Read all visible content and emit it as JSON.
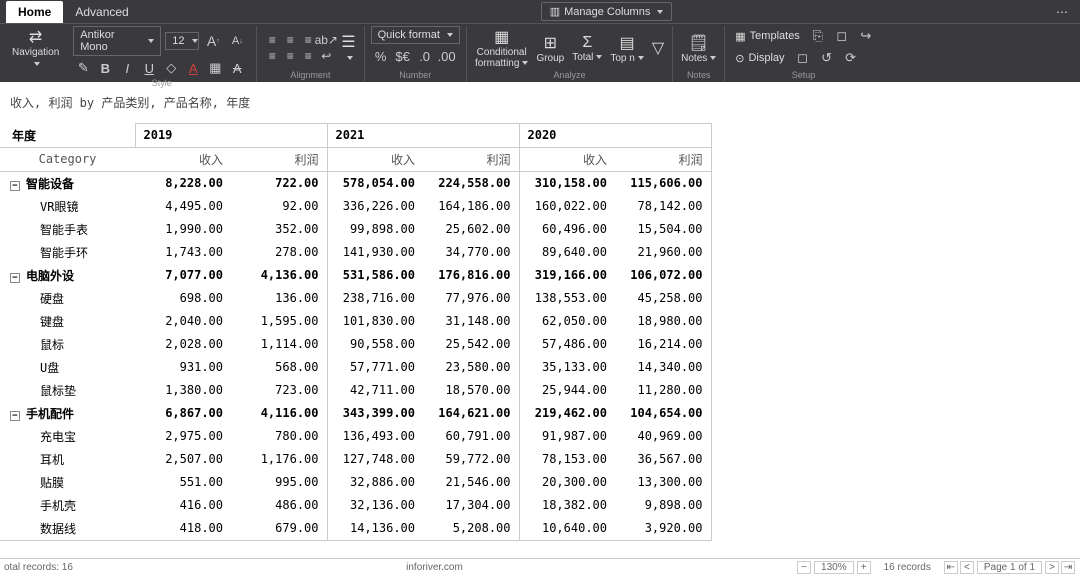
{
  "tabs": {
    "home": "Home",
    "advanced": "Advanced"
  },
  "manage_columns": "Manage Columns",
  "navigation": "Navigation",
  "font": {
    "name": "Antikor Mono",
    "size": "12",
    "increase": "A",
    "decrease": "A"
  },
  "quick_format": "Quick format",
  "analyze": {
    "conditional": "Conditional",
    "formatting": "formatting",
    "group": "Group",
    "total": "Total",
    "topn": "Top n"
  },
  "notes": "Notes",
  "setup": {
    "templates": "Templates",
    "display": "Display"
  },
  "group_labels": {
    "style": "Style",
    "alignment": "Alignment",
    "number": "Number",
    "analyze": "Analyze",
    "notes": "Notes",
    "setup": "Setup"
  },
  "caption": "收入, 利润 by 产品类别, 产品名称, 年度",
  "table": {
    "header": {
      "year_label": "年度",
      "category": "Category",
      "years": [
        "2019",
        "2021",
        "2020"
      ],
      "metrics": [
        "收入",
        "利润"
      ]
    },
    "groups": [
      {
        "name": "智能设备",
        "totals": [
          "8,228.00",
          "722.00",
          "578,054.00",
          "224,558.00",
          "310,158.00",
          "115,606.00"
        ],
        "rows": [
          {
            "name": "VR眼镜",
            "v": [
              "4,495.00",
              "92.00",
              "336,226.00",
              "164,186.00",
              "160,022.00",
              "78,142.00"
            ]
          },
          {
            "name": "智能手表",
            "v": [
              "1,990.00",
              "352.00",
              "99,898.00",
              "25,602.00",
              "60,496.00",
              "15,504.00"
            ]
          },
          {
            "name": "智能手环",
            "v": [
              "1,743.00",
              "278.00",
              "141,930.00",
              "34,770.00",
              "89,640.00",
              "21,960.00"
            ]
          }
        ]
      },
      {
        "name": "电脑外设",
        "totals": [
          "7,077.00",
          "4,136.00",
          "531,586.00",
          "176,816.00",
          "319,166.00",
          "106,072.00"
        ],
        "rows": [
          {
            "name": "硬盘",
            "v": [
              "698.00",
              "136.00",
              "238,716.00",
              "77,976.00",
              "138,553.00",
              "45,258.00"
            ]
          },
          {
            "name": "键盘",
            "v": [
              "2,040.00",
              "1,595.00",
              "101,830.00",
              "31,148.00",
              "62,050.00",
              "18,980.00"
            ]
          },
          {
            "name": "鼠标",
            "v": [
              "2,028.00",
              "1,114.00",
              "90,558.00",
              "25,542.00",
              "57,486.00",
              "16,214.00"
            ]
          },
          {
            "name": "U盘",
            "v": [
              "931.00",
              "568.00",
              "57,771.00",
              "23,580.00",
              "35,133.00",
              "14,340.00"
            ]
          },
          {
            "name": "鼠标垫",
            "v": [
              "1,380.00",
              "723.00",
              "42,711.00",
              "18,570.00",
              "25,944.00",
              "11,280.00"
            ]
          }
        ]
      },
      {
        "name": "手机配件",
        "totals": [
          "6,867.00",
          "4,116.00",
          "343,399.00",
          "164,621.00",
          "219,462.00",
          "104,654.00"
        ],
        "rows": [
          {
            "name": "充电宝",
            "v": [
              "2,975.00",
              "780.00",
              "136,493.00",
              "60,791.00",
              "91,987.00",
              "40,969.00"
            ]
          },
          {
            "name": "耳机",
            "v": [
              "2,507.00",
              "1,176.00",
              "127,748.00",
              "59,772.00",
              "78,153.00",
              "36,567.00"
            ]
          },
          {
            "name": "贴膜",
            "v": [
              "551.00",
              "995.00",
              "32,886.00",
              "21,546.00",
              "20,300.00",
              "13,300.00"
            ]
          },
          {
            "name": "手机壳",
            "v": [
              "416.00",
              "486.00",
              "32,136.00",
              "17,304.00",
              "18,382.00",
              "9,898.00"
            ]
          },
          {
            "name": "数据线",
            "v": [
              "418.00",
              "679.00",
              "14,136.00",
              "5,208.00",
              "10,640.00",
              "3,920.00"
            ]
          }
        ]
      }
    ]
  },
  "status": {
    "total_records": "otal records: 16",
    "site": "inforiver.com",
    "zoom": "130%",
    "records": "16 records",
    "page": "Page 1 of 1"
  }
}
